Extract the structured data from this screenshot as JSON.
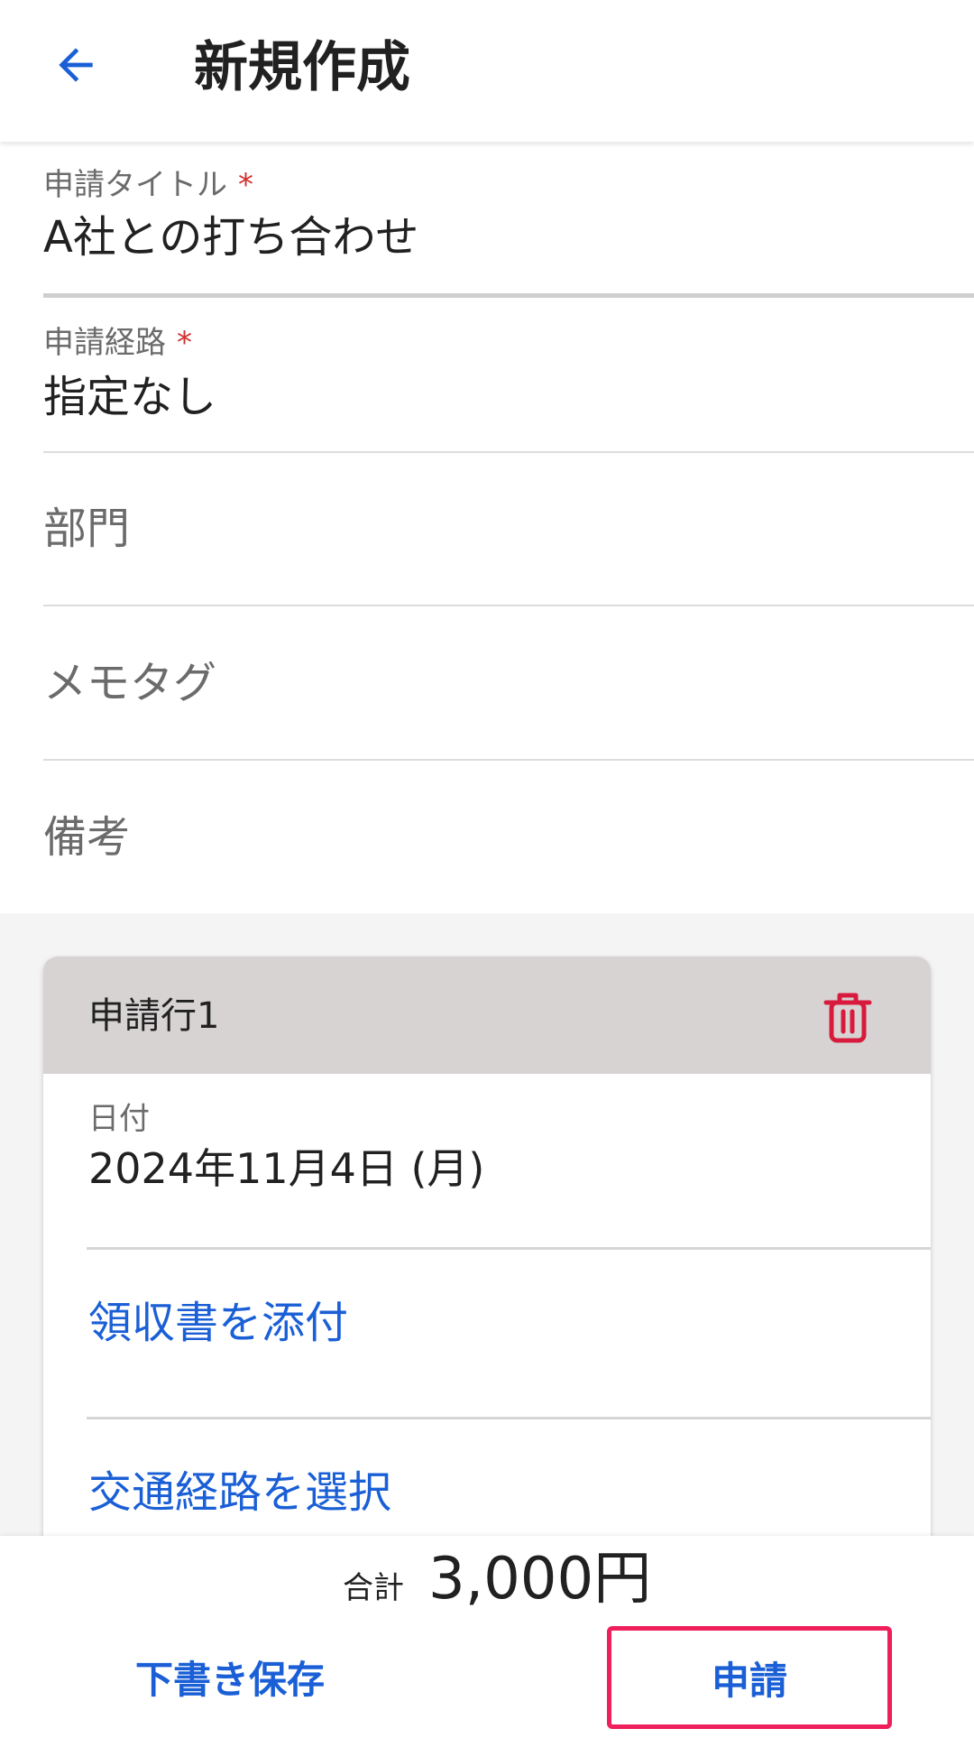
{
  "header": {
    "title": "新規作成",
    "back_icon": "arrow-left-icon"
  },
  "form": {
    "required_mark": "*",
    "title_field": {
      "label": "申請タイトル",
      "value": "A社との打ち合わせ"
    },
    "route_field": {
      "label": "申請経路",
      "value": "指定なし"
    },
    "department_field": {
      "placeholder": "部門"
    },
    "memo_tag_field": {
      "placeholder": "メモタグ"
    },
    "remarks_field": {
      "placeholder": "備考"
    }
  },
  "card": {
    "title": "申請行1",
    "delete_icon": "trash-icon",
    "date_label": "日付",
    "date_value": "2024年11月4日 (月)",
    "attach_receipt": "領収書を添付",
    "select_route": "交通経路を選択"
  },
  "footer": {
    "total_label": "合計",
    "total_value": "3,000円",
    "draft_label": "下書き保存",
    "submit_label": "申請"
  },
  "colors": {
    "accent": "#1a5fd6",
    "required": "#d32f2f",
    "delete": "#d81b3c",
    "highlight_border": "#ee1f5b"
  }
}
